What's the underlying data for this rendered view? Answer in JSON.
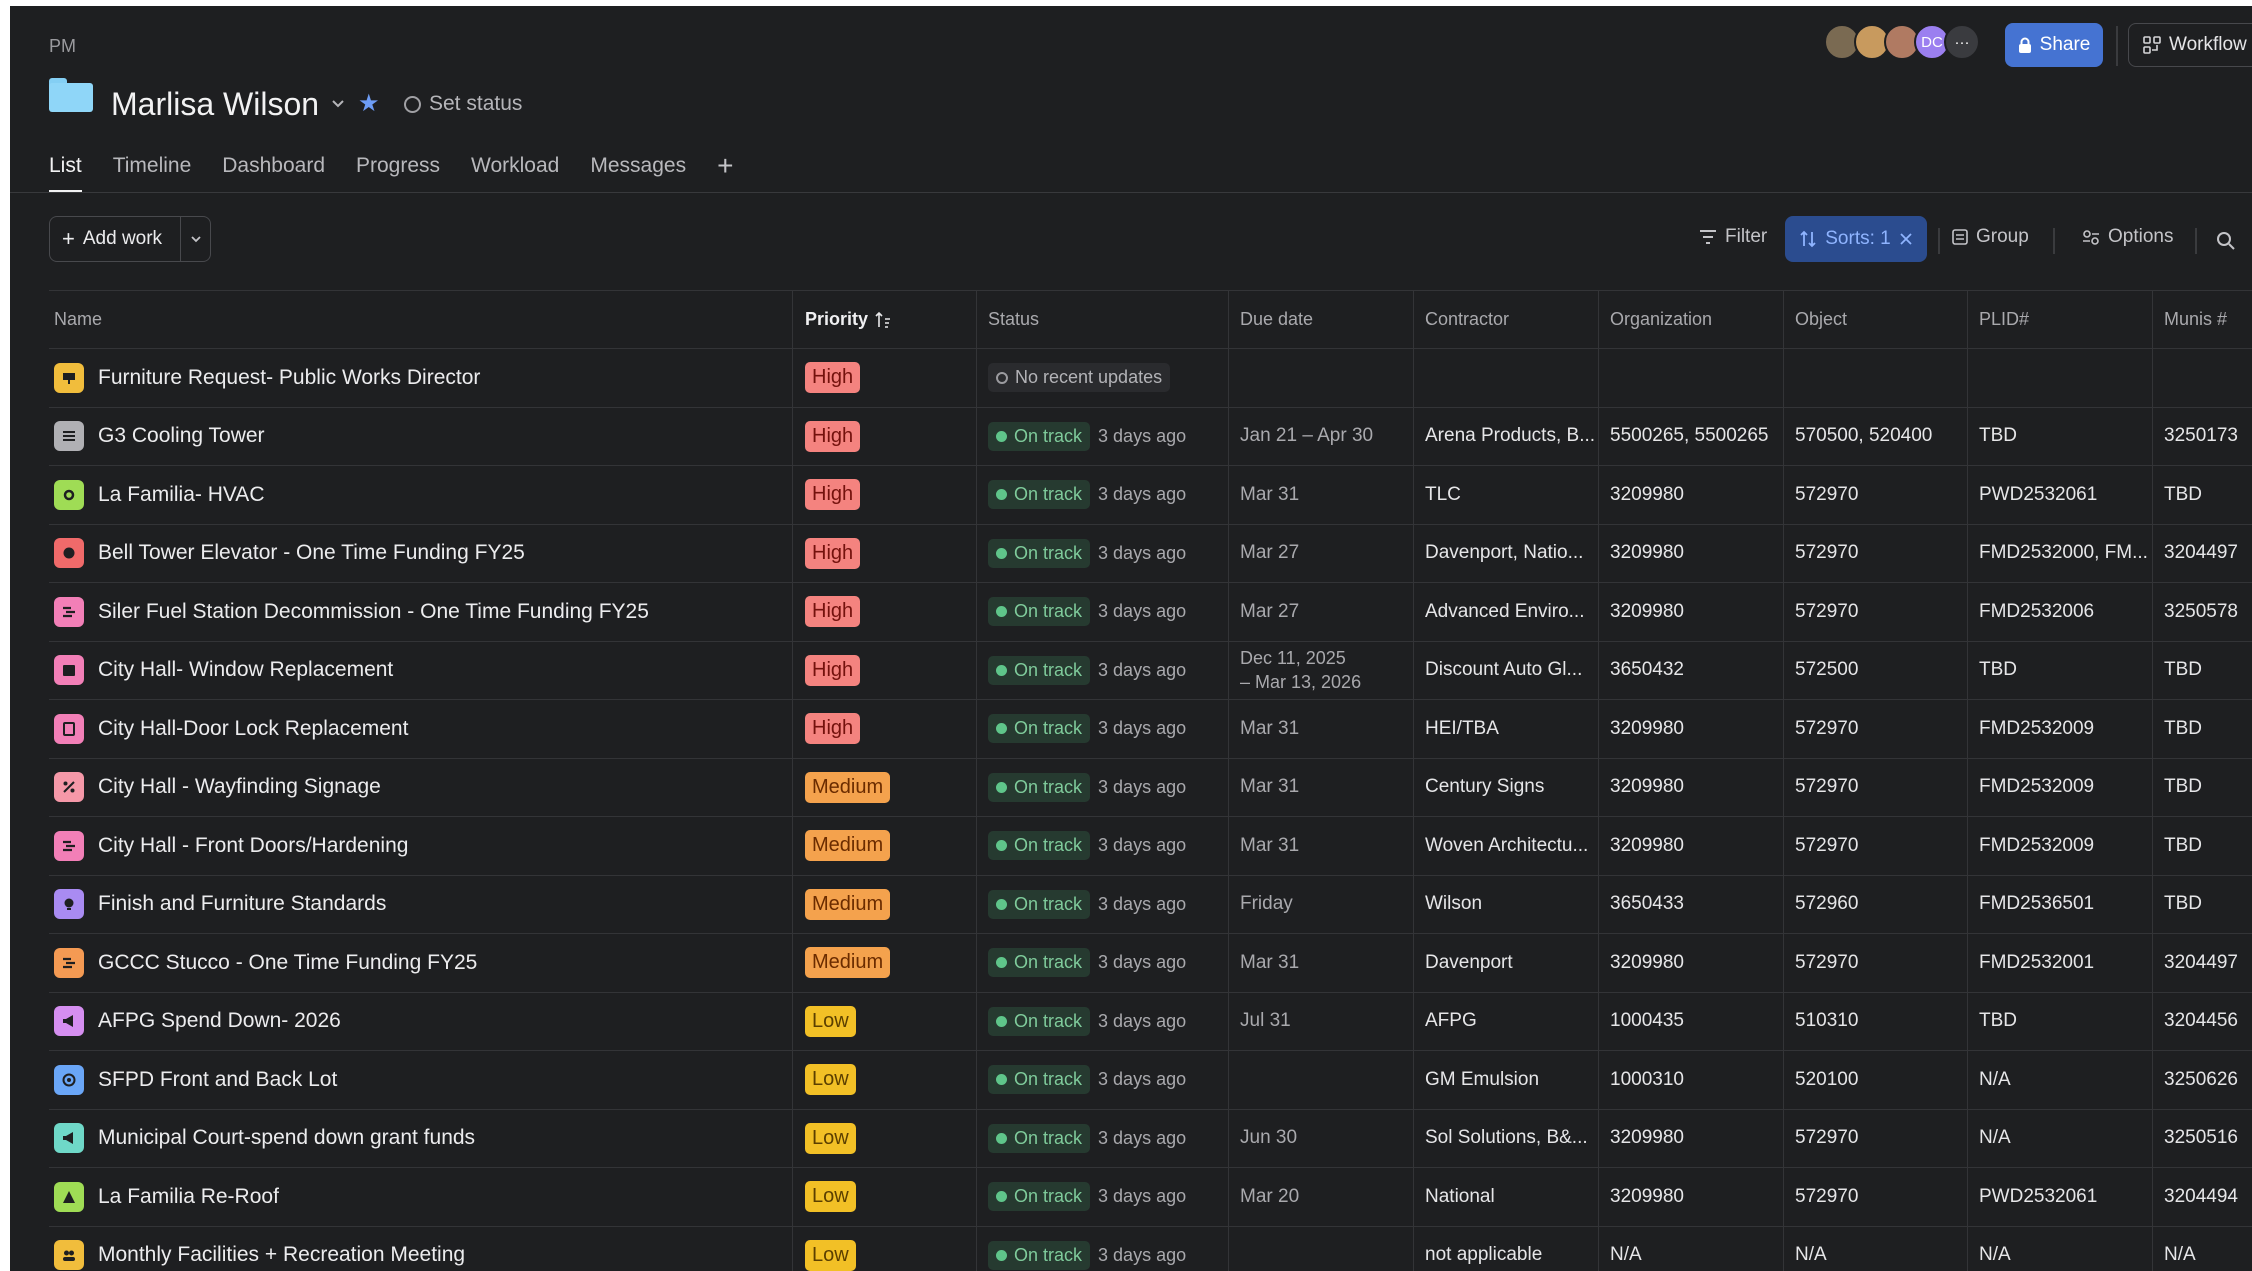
{
  "header": {
    "breadcrumb": "PM",
    "project_title": "Marlisa Wilson",
    "set_status_label": "Set status",
    "avatars": [
      {
        "label": "",
        "color": "#7a6a52"
      },
      {
        "label": "",
        "color": "#c89a5e"
      },
      {
        "label": "",
        "color": "#b07a62"
      },
      {
        "label": "DC",
        "color": "#9b7ff0"
      },
      {
        "label": "···",
        "color": "#3a3b3f"
      }
    ],
    "share_label": "Share",
    "workflow_label": "Workflow"
  },
  "tabs": [
    "List",
    "Timeline",
    "Dashboard",
    "Progress",
    "Workload",
    "Messages"
  ],
  "toolbar": {
    "add_work_label": "Add work",
    "filter_label": "Filter",
    "sorts_label": "Sorts: 1",
    "group_label": "Group",
    "options_label": "Options"
  },
  "columns": {
    "name": "Name",
    "priority": "Priority",
    "status": "Status",
    "due_date": "Due date",
    "contractor": "Contractor",
    "organization": "Organization",
    "object": "Object",
    "plid": "PLID#",
    "munis": "Munis #"
  },
  "colors": {
    "accent": "#4573d2",
    "high": "#f4837f",
    "medium": "#f4a24d",
    "low": "#f2c026",
    "on_track": "#5fc58a"
  },
  "rows": [
    {
      "icon": "presentation-icon",
      "icon_color": "#f1bd3c",
      "name": "Furniture Request- Public Works Director",
      "priority": "High",
      "priority_class": "high",
      "status": "No recent updates",
      "status_class": "none",
      "age": "",
      "due": "",
      "due2": "",
      "contractor": "",
      "organization": "",
      "object": "",
      "plid": "",
      "munis": ""
    },
    {
      "icon": "list-icon",
      "icon_color": "#b0b0b4",
      "name": "G3 Cooling Tower",
      "priority": "High",
      "priority_class": "high",
      "status": "On track",
      "status_class": "",
      "age": "3 days ago",
      "due": "Jan 21 – Apr 30",
      "due2": "",
      "contractor": "Arena Products, B...",
      "organization": "5500265, 5500265",
      "object": "570500, 520400",
      "plid": "TBD",
      "munis": "3250173"
    },
    {
      "icon": "gear-icon",
      "icon_color": "#9fdc55",
      "name": "La Familia- HVAC",
      "priority": "High",
      "priority_class": "high",
      "status": "On track",
      "status_class": "",
      "age": "3 days ago",
      "due": "Mar 31",
      "due2": "",
      "contractor": "TLC",
      "organization": "3209980",
      "object": "572970",
      "plid": "PWD2532061",
      "munis": "TBD"
    },
    {
      "icon": "brain-icon",
      "icon_color": "#f06a6a",
      "name": "Bell Tower Elevator - One Time Funding FY25",
      "priority": "High",
      "priority_class": "high",
      "status": "On track",
      "status_class": "",
      "age": "3 days ago",
      "due": "Mar 27",
      "due2": "",
      "contractor": "Davenport, Natio...",
      "organization": "3209980",
      "object": "572970",
      "plid": "FMD2532000, FM...",
      "munis": "3204497"
    },
    {
      "icon": "timeline-icon",
      "icon_color": "#f27fb7",
      "name": "Siler Fuel Station Decommission - One Time Funding FY25",
      "priority": "High",
      "priority_class": "high",
      "status": "On track",
      "status_class": "",
      "age": "3 days ago",
      "due": "Mar 27",
      "due2": "",
      "contractor": "Advanced Enviro...",
      "organization": "3209980",
      "object": "572970",
      "plid": "FMD2532006",
      "munis": "3250578"
    },
    {
      "icon": "calendar-icon",
      "icon_color": "#f27fb7",
      "name": "City Hall- Window Replacement",
      "priority": "High",
      "priority_class": "high",
      "status": "On track",
      "status_class": "",
      "age": "3 days ago",
      "due": "Dec 11, 2025",
      "due2": "– Mar 13, 2026",
      "contractor": "Discount Auto Gl...",
      "organization": "3650432",
      "object": "572500",
      "plid": "TBD",
      "munis": "TBD"
    },
    {
      "icon": "book-icon",
      "icon_color": "#f27fb7",
      "name": "City Hall-Door Lock Replacement",
      "priority": "High",
      "priority_class": "high",
      "status": "On track",
      "status_class": "",
      "age": "3 days ago",
      "due": "Mar 31",
      "due2": "",
      "contractor": "HEI/TBA",
      "organization": "3209980",
      "object": "572970",
      "plid": "FMD2532009",
      "munis": "TBD"
    },
    {
      "icon": "percent-icon",
      "icon_color": "#f598a8",
      "name": "City Hall - Wayfinding Signage",
      "priority": "Medium",
      "priority_class": "medium",
      "status": "On track",
      "status_class": "",
      "age": "3 days ago",
      "due": "Mar 31",
      "due2": "",
      "contractor": "Century Signs",
      "organization": "3209980",
      "object": "572970",
      "plid": " FMD2532009",
      "munis": "TBD"
    },
    {
      "icon": "timeline-icon",
      "icon_color": "#f27fb7",
      "name": "City Hall - Front Doors/Hardening",
      "priority": "Medium",
      "priority_class": "medium",
      "status": "On track",
      "status_class": "",
      "age": "3 days ago",
      "due": "Mar 31",
      "due2": "",
      "contractor": "Woven Architectu...",
      "organization": "3209980",
      "object": "572970",
      "plid": "FMD2532009",
      "munis": "TBD"
    },
    {
      "icon": "lightbulb-icon",
      "icon_color": "#a98bf2",
      "name": "Finish and Furniture Standards",
      "priority": "Medium",
      "priority_class": "medium",
      "status": "On track",
      "status_class": "",
      "age": "3 days ago",
      "due": "Friday",
      "due2": "",
      "contractor": "Wilson",
      "organization": "3650433",
      "object": "572960",
      "plid": "FMD2536501",
      "munis": "TBD"
    },
    {
      "icon": "timeline-icon",
      "icon_color": "#f49a53",
      "name": "GCCC Stucco - One Time Funding FY25",
      "priority": "Medium",
      "priority_class": "medium",
      "status": "On track",
      "status_class": "",
      "age": "3 days ago",
      "due": "Mar 31",
      "due2": "",
      "contractor": "Davenport",
      "organization": "3209980",
      "object": "572970",
      "plid": "FMD2532001",
      "munis": "3204497"
    },
    {
      "icon": "megaphone-icon",
      "icon_color": "#d58ef0",
      "name": "AFPG Spend Down- 2026",
      "priority": "Low",
      "priority_class": "low",
      "status": "On track",
      "status_class": "",
      "age": "3 days ago",
      "due": "Jul 31",
      "due2": "",
      "contractor": "AFPG",
      "organization": "1000435",
      "object": "510310",
      "plid": "TBD",
      "munis": "3204456"
    },
    {
      "icon": "target-icon",
      "icon_color": "#6aa6f7",
      "name": "SFPD Front and Back Lot",
      "priority": "Low",
      "priority_class": "low",
      "status": "On track",
      "status_class": "",
      "age": "3 days ago",
      "due": "",
      "due2": "",
      "contractor": "GM Emulsion",
      "organization": "1000310",
      "object": "520100",
      "plid": "N/A",
      "munis": "3250626"
    },
    {
      "icon": "megaphone-icon",
      "icon_color": "#6fd8c8",
      "name": "Municipal Court-spend down grant funds",
      "priority": "Low",
      "priority_class": "low",
      "status": "On track",
      "status_class": "",
      "age": "3 days ago",
      "due": "Jun 30",
      "due2": "",
      "contractor": "Sol Solutions, B&...",
      "organization": "3209980",
      "object": "572970",
      "plid": "N/A",
      "munis": "3250516"
    },
    {
      "icon": "mountain-icon",
      "icon_color": "#9fdc55",
      "name": "La Familia Re-Roof",
      "priority": "Low",
      "priority_class": "low",
      "status": "On track",
      "status_class": "",
      "age": "3 days ago",
      "due": "Mar 20",
      "due2": "",
      "contractor": "National",
      "organization": "3209980",
      "object": "572970",
      "plid": "PWD2532061",
      "munis": "3204494"
    },
    {
      "icon": "people-icon",
      "icon_color": "#f1bd3c",
      "name": "Monthly Facilities + Recreation Meeting",
      "priority": "Low",
      "priority_class": "low",
      "status": "On track",
      "status_class": "",
      "age": "3 days ago",
      "due": "",
      "due2": "",
      "contractor": "not applicable",
      "organization": "N/A",
      "object": "N/A",
      "plid": "N/A",
      "munis": "N/A"
    }
  ]
}
